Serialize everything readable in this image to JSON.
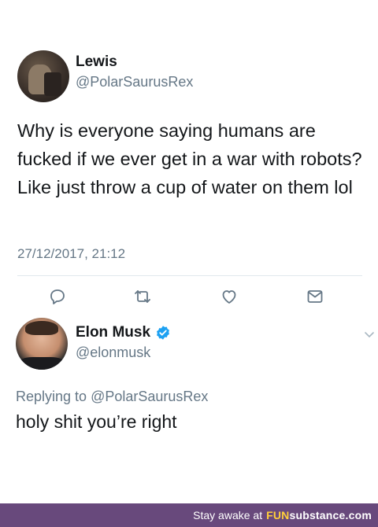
{
  "original_tweet": {
    "display_name": "Lewis",
    "handle": "@PolarSaurusRex",
    "text": "Why is everyone saying humans are fucked if we ever get in a war with robots? Like just throw a cup of water on them lol",
    "timestamp": "27/12/2017, 21:12",
    "actions": [
      "reply-icon",
      "retweet-icon",
      "like-icon",
      "message-icon"
    ]
  },
  "reply_tweet": {
    "display_name": "Elon Musk",
    "handle": "@elonmusk",
    "verified": true,
    "replying_prefix": "Replying to",
    "replying_to": "@PolarSaurusRex",
    "text": "holy shit you’re right"
  },
  "footer": {
    "tagline": "Stay awake at",
    "brand_prefix": "FUN",
    "brand_suffix": "substance",
    "brand_domain": ".com"
  },
  "colors": {
    "text": "#14171a",
    "secondary": "#657786",
    "verified": "#1da1f2",
    "footer_bg": "#68497c"
  }
}
